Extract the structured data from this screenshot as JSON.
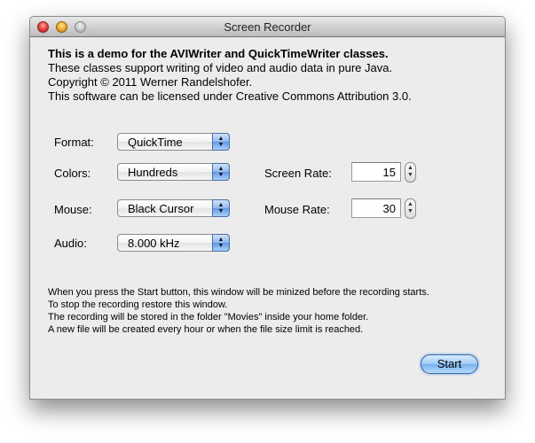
{
  "window": {
    "title": "Screen Recorder",
    "controls": [
      "close",
      "minimize",
      "zoom"
    ]
  },
  "intro": {
    "heading": "This is a demo for the AVIWriter and QuickTimeWriter classes.",
    "lines": [
      "These classes support writing of video and audio data in pure Java.",
      "Copyright © 2011 Werner Randelshofer.",
      "This software can be licensed under Creative Commons Attribution 3.0."
    ]
  },
  "settings": {
    "format": {
      "label": "Format:",
      "value": "QuickTime"
    },
    "colors": {
      "label": "Colors:",
      "value": "Hundreds"
    },
    "mouse": {
      "label": "Mouse:",
      "value": "Black Cursor"
    },
    "audio": {
      "label": "Audio:",
      "value": "8.000 kHz"
    },
    "screen_rate": {
      "label": "Screen Rate:",
      "value": "15"
    },
    "mouse_rate": {
      "label": "Mouse Rate:",
      "value": "30"
    }
  },
  "notes": [
    "When you press the Start button, this window will be minized before the recording starts.",
    "To stop the recording restore this window.",
    "The recording will be stored in the folder \"Movies\" inside your home folder.",
    "A new file will be created every hour or when the file size limit is reached."
  ],
  "icons": {
    "popup_arrows": "▲▼",
    "stepper_up": "▲",
    "stepper_down": "▼"
  },
  "actions": {
    "start_label": "Start"
  }
}
